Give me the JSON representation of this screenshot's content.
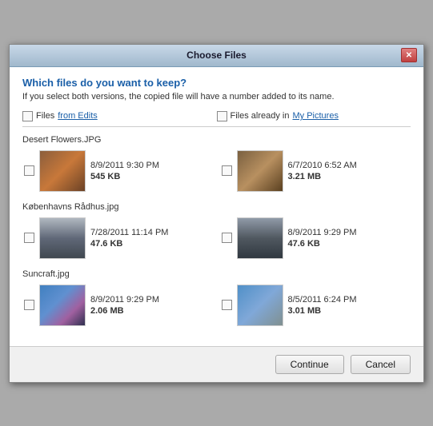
{
  "titleBar": {
    "title": "Choose Files",
    "closeLabel": "✕"
  },
  "header": {
    "question": "Which files do you want to keep?",
    "subtext": "If you select both versions, the copied file will have a number added to its name."
  },
  "columns": {
    "left": {
      "prefix": "Files ",
      "linkText": "from Edits",
      "suffix": ""
    },
    "right": {
      "prefix": "Files already in ",
      "linkText": "My Pictures",
      "suffix": ""
    }
  },
  "files": [
    {
      "name": "Desert Flowers.JPG",
      "left": {
        "date": "8/9/2011 9:30 PM",
        "size": "545 KB"
      },
      "right": {
        "date": "6/7/2010 6:52 AM",
        "size": "3.21 MB"
      }
    },
    {
      "name": "Københavns Rådhus.jpg",
      "left": {
        "date": "7/28/2011 11:14 PM",
        "size": "47.6 KB"
      },
      "right": {
        "date": "8/9/2011 9:29 PM",
        "size": "47.6 KB"
      }
    },
    {
      "name": "Suncraft.jpg",
      "left": {
        "date": "8/9/2011 9:29 PM",
        "size": "2.06 MB"
      },
      "right": {
        "date": "8/5/2011 6:24 PM",
        "size": "3.01 MB"
      }
    }
  ],
  "buttons": {
    "continue": "Continue",
    "cancel": "Cancel"
  }
}
